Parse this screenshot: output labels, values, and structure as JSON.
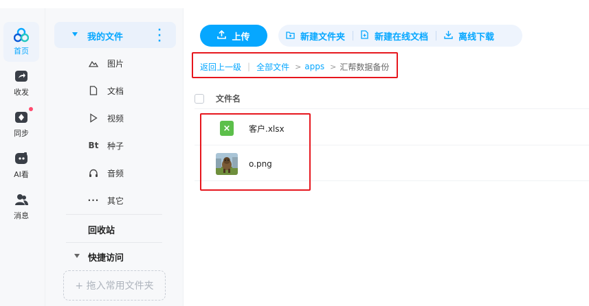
{
  "rail": {
    "items": [
      {
        "label": "首页",
        "icon": "home-logo-icon",
        "active": true
      },
      {
        "label": "收发",
        "icon": "share-icon"
      },
      {
        "label": "同步",
        "icon": "sync-icon",
        "badge": true
      },
      {
        "label": "AI看",
        "icon": "ai-view-icon"
      },
      {
        "label": "消息",
        "icon": "message-icon"
      }
    ]
  },
  "tree": {
    "my_files": "我的文件",
    "categories": [
      {
        "label": "图片",
        "icon": "image-icon"
      },
      {
        "label": "文档",
        "icon": "document-icon"
      },
      {
        "label": "视频",
        "icon": "video-icon"
      },
      {
        "label": "种子",
        "icon": "torrent-icon"
      },
      {
        "label": "音频",
        "icon": "audio-icon"
      },
      {
        "label": "其它",
        "icon": "more-icon"
      }
    ],
    "recycle": "回收站",
    "quick_access": "快捷访问",
    "drop_hint": "+ 拖入常用文件夹"
  },
  "toolbar": {
    "upload": "上传",
    "new_folder": "新建文件夹",
    "new_online_doc": "新建在线文档",
    "offline_download": "离线下载"
  },
  "breadcrumb": {
    "back": "返回上一级",
    "all_files": "全部文件",
    "path": [
      "apps"
    ],
    "current": "汇帮数据备份"
  },
  "table": {
    "header_name": "文件名",
    "rows": [
      {
        "name": "客户.xlsx",
        "type": "xlsx"
      },
      {
        "name": "o.png",
        "type": "png"
      }
    ]
  },
  "colors": {
    "accent": "#06a7ff",
    "highlight": "#e6161d",
    "excel": "#5cbf4a"
  }
}
